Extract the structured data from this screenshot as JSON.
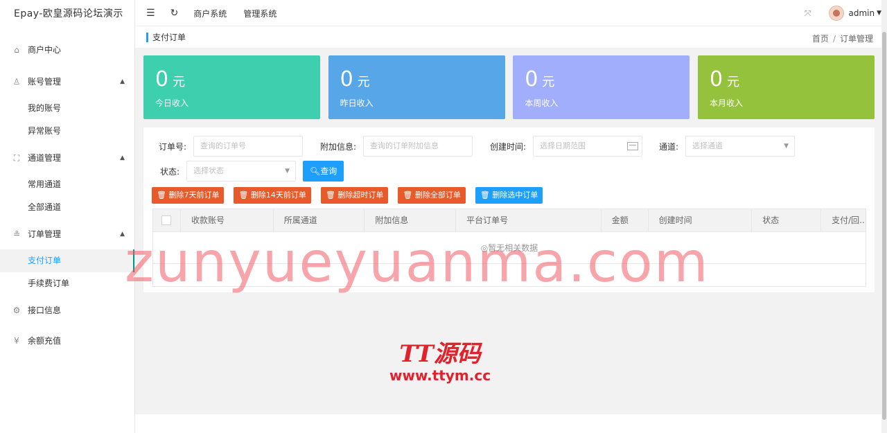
{
  "brand": "Epay-欧皇源码论坛演示",
  "sidebar": {
    "items": [
      {
        "label": "商户中心",
        "icon": "home-icon",
        "symbol": "⌂"
      },
      {
        "label": "账号管理",
        "icon": "user-icon",
        "symbol": "♙",
        "expanded": true,
        "children": [
          "我的账号",
          "异常账号"
        ]
      },
      {
        "label": "通道管理",
        "icon": "channel-icon",
        "symbol": "⛶",
        "expanded": true,
        "children": [
          "常用通道",
          "全部通道"
        ]
      },
      {
        "label": "订单管理",
        "icon": "order-icon",
        "symbol": "≗",
        "expanded": true,
        "children": [
          "支付订单",
          "手续费订单"
        ]
      },
      {
        "label": "接口信息",
        "icon": "gear-icon",
        "symbol": "⚙"
      },
      {
        "label": "余额充值",
        "icon": "yen-icon",
        "symbol": "¥"
      }
    ],
    "active_child": "支付订单"
  },
  "header": {
    "links": [
      "商户系统",
      "管理系统"
    ],
    "user": "admin"
  },
  "breadcrumb": {
    "page_title": "支付订单",
    "home": "首页",
    "current": "订单管理"
  },
  "cards": [
    {
      "value": "0",
      "unit": "元",
      "label": "今日收入",
      "color": "#3ed0ae"
    },
    {
      "value": "0",
      "unit": "元",
      "label": "昨日收入",
      "color": "#56a6e8"
    },
    {
      "value": "0",
      "unit": "元",
      "label": "本周收入",
      "color": "#a0aefc"
    },
    {
      "value": "0",
      "unit": "元",
      "label": "本月收入",
      "color": "#95c23d"
    }
  ],
  "filters": {
    "order_no": {
      "label": "订单号:",
      "placeholder": "查询的订单号"
    },
    "extra": {
      "label": "附加信息:",
      "placeholder": "查询的订单附加信息"
    },
    "created": {
      "label": "创建时间:",
      "placeholder": "选择日期范围"
    },
    "channel": {
      "label": "通道:",
      "placeholder": "选择通道"
    },
    "status": {
      "label": "状态:",
      "placeholder": "选择状态"
    },
    "query_button": "查询"
  },
  "actions": {
    "del_7": "删除7天前订单",
    "del_14": "删除14天前订单",
    "del_timeout": "删除超时订单",
    "del_all": "删除全部订单",
    "del_selected": "删除选中订单"
  },
  "table": {
    "columns": [
      "收款账号",
      "所属通道",
      "附加信息",
      "平台订单号",
      "金额",
      "创建时间",
      "状态",
      "支付/回..."
    ],
    "empty_text": "◎暂无相关数据"
  },
  "watermark": "zunyueyuanma.com",
  "logo_watermark": {
    "name": "TT源码",
    "url": "www.ttym.cc"
  },
  "colors": {
    "accent": "#1E9FFF",
    "danger": "#e85a29"
  }
}
